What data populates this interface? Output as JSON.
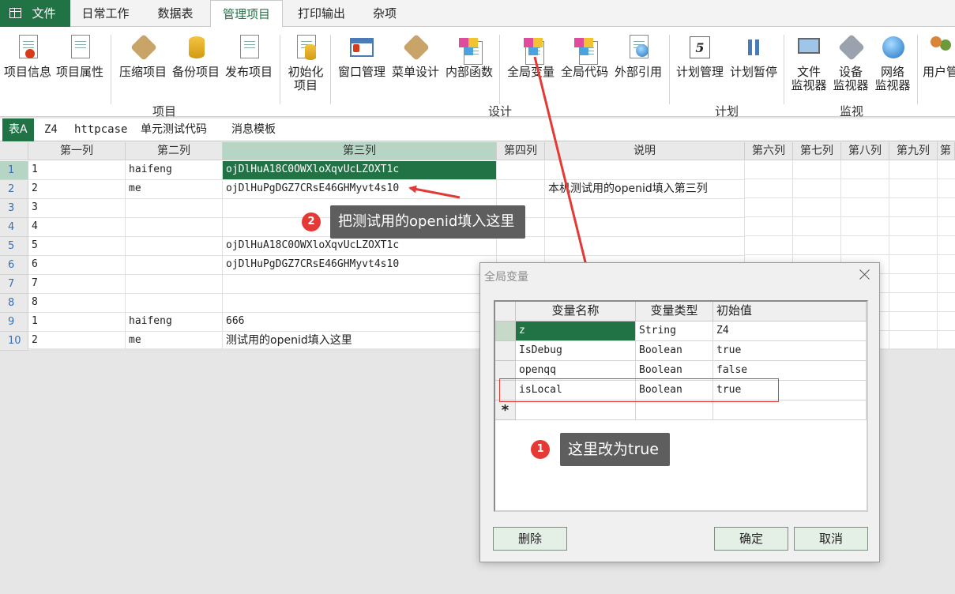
{
  "tabs": [
    "文件",
    "日常工作",
    "数据表",
    "管理项目",
    "打印输出",
    "杂项"
  ],
  "ribbon": {
    "buttons": [
      {
        "label": "项目信息"
      },
      {
        "label": "项目属性"
      },
      {
        "label": "压缩项目"
      },
      {
        "label": "备份项目"
      },
      {
        "label": "发布项目"
      },
      {
        "label1": "初始化",
        "label2": "项目"
      },
      {
        "label": "窗口管理"
      },
      {
        "label": "菜单设计"
      },
      {
        "label": "内部函数"
      },
      {
        "label": "全局变量"
      },
      {
        "label": "全局代码"
      },
      {
        "label": "外部引用"
      },
      {
        "label": "计划管理"
      },
      {
        "label": "计划暂停"
      },
      {
        "label1": "文件",
        "label2": "监视器"
      },
      {
        "label1": "设备",
        "label2": "监视器"
      },
      {
        "label1": "网络",
        "label2": "监视器"
      },
      {
        "label": "用户管"
      }
    ],
    "groups": [
      "项目",
      "设计",
      "计划",
      "监视"
    ]
  },
  "sheet_tabs": [
    "表A",
    "Z4",
    "httpcase",
    "单元测试代码",
    "消息模板"
  ],
  "grid": {
    "columns": [
      "第一列",
      "第二列",
      "第三列",
      "第四列",
      "说明",
      "第六列",
      "第七列",
      "第八列",
      "第九列",
      "第"
    ],
    "rows": [
      {
        "n": "1",
        "c1": "1",
        "c2": "haifeng",
        "c3": "ojDlHuA18C0OWXloXqvUcLZOXT1c",
        "c4": "",
        "c5": ""
      },
      {
        "n": "2",
        "c1": "2",
        "c2": "me",
        "c3": "ojDlHuPgDGZ7CRsE46GHMyvt4s10",
        "c4": "",
        "c5": "本机测试用的openid填入第三列"
      },
      {
        "n": "3",
        "c1": "3",
        "c2": "",
        "c3": "",
        "c4": "",
        "c5": ""
      },
      {
        "n": "4",
        "c1": "4",
        "c2": "",
        "c3": "",
        "c4": "",
        "c5": ""
      },
      {
        "n": "5",
        "c1": "5",
        "c2": "",
        "c3": "ojDlHuA18C0OWXloXqvUcLZOXT1c",
        "c4": "",
        "c5": ""
      },
      {
        "n": "6",
        "c1": "6",
        "c2": "",
        "c3": "ojDlHuPgDGZ7CRsE46GHMyvt4s10",
        "c4": "",
        "c5": ""
      },
      {
        "n": "7",
        "c1": "7",
        "c2": "",
        "c3": "",
        "c4": "",
        "c5": ""
      },
      {
        "n": "8",
        "c1": "8",
        "c2": "",
        "c3": "",
        "c4": "",
        "c5": ""
      },
      {
        "n": "9",
        "c1": "1",
        "c2": "haifeng",
        "c3": "666",
        "c4": "",
        "c5": ""
      },
      {
        "n": "10",
        "c1": "2",
        "c2": "me",
        "c3": "测试用的openid填入这里",
        "c4": "",
        "c5": ""
      }
    ]
  },
  "annotations": {
    "note1": "这里改为true",
    "note2": "把测试用的openid填入这里",
    "num1": "1",
    "num2": "2"
  },
  "dialog": {
    "title": "全局变量",
    "headers": [
      "变量名称",
      "变量类型",
      "初始值"
    ],
    "rows": [
      {
        "name": "z",
        "type": "String",
        "init": "Z4"
      },
      {
        "name": "IsDebug",
        "type": "Boolean",
        "init": "true"
      },
      {
        "name": "openqq",
        "type": "Boolean",
        "init": "false"
      },
      {
        "name": "isLocal",
        "type": "Boolean",
        "init": "true"
      }
    ],
    "new_row_marker": "*",
    "delete_label": "删除",
    "ok_label": "确定",
    "cancel_label": "取消"
  },
  "colors": {
    "accent": "#217346",
    "annotation": "#e53935",
    "note_bg": "#5e5e5e"
  }
}
